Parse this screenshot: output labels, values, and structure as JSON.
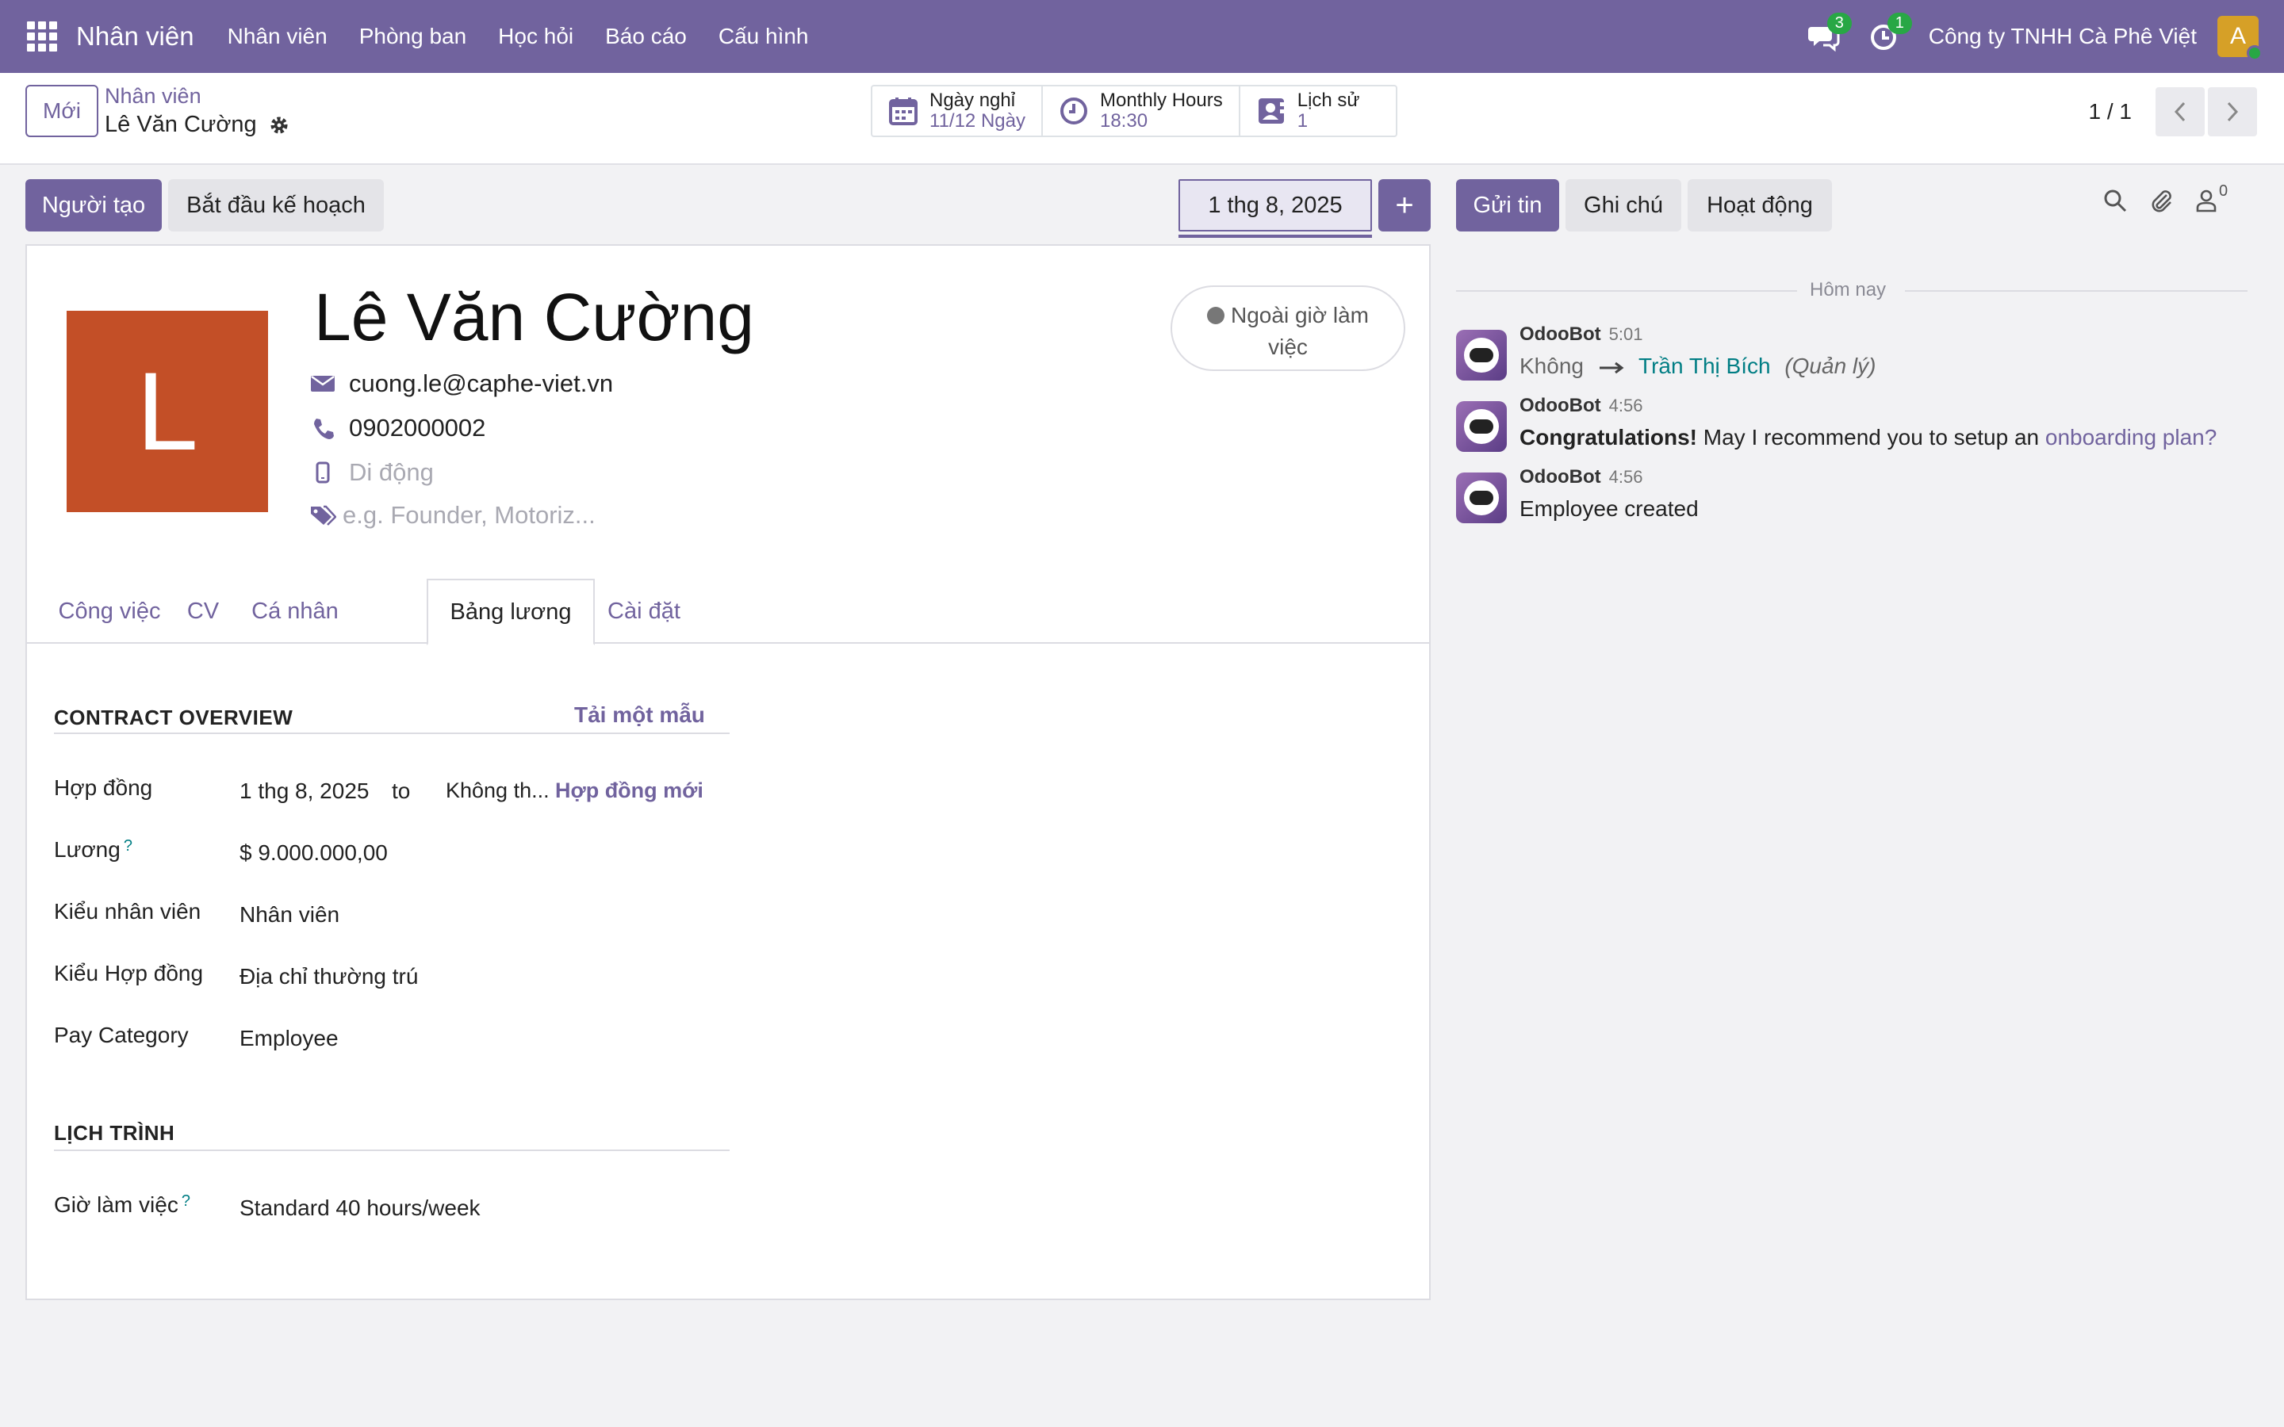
{
  "navbar": {
    "brand": "Nhân viên",
    "menu": [
      "Nhân viên",
      "Phòng ban",
      "Học hỏi",
      "Báo cáo",
      "Cấu hình"
    ],
    "messages_count": "3",
    "activities_count": "1",
    "company": "Công ty TNHH Cà Phê Việt",
    "avatar_letter": "A"
  },
  "control": {
    "new_label": "Mới",
    "breadcrumb_parent": "Nhân viên",
    "breadcrumb_current": "Lê Văn Cường",
    "smart_buttons": [
      {
        "title": "Ngày nghỉ",
        "value": "11/12 Ngày",
        "icon": "calendar-icon"
      },
      {
        "title": "Monthly Hours",
        "value": "18:30",
        "icon": "clock-icon"
      },
      {
        "title": "Lịch sử",
        "value": "1",
        "icon": "contact-card-icon"
      }
    ],
    "pager": "1 / 1"
  },
  "actions": {
    "creator": "Người tạo",
    "start_plan": "Bắt đầu kế hoạch",
    "date": "1 thg 8, 2025",
    "add_symbol": "+"
  },
  "employee": {
    "avatar_letter": "L",
    "name": "Lê Văn Cường",
    "email": "cuong.le@caphe-viet.vn",
    "phone": "0902000002",
    "mobile_placeholder": "Di động",
    "tags_placeholder": "e.g. Founder, Motoriz...",
    "status_line1": "Ngoài giờ làm",
    "status_line2": "việc"
  },
  "tabs": [
    "Công việc",
    "CV",
    "Cá nhân",
    "Bảng lương",
    "Cài đặt"
  ],
  "active_tab": "Bảng lương",
  "payroll": {
    "contract_title": "CONTRACT OVERVIEW",
    "load_template": "Tải một mẫu",
    "contract_label": "Hợp đồng",
    "contract_start": "1 thg 8, 2025",
    "contract_to": "to",
    "contract_end_placeholder": "Không th...",
    "new_contract": "Hợp đồng mới",
    "wage_label": "Lương",
    "wage_value": "$ 9.000.000,00",
    "employee_type_label": "Kiểu nhân viên",
    "employee_type_value": "Nhân viên",
    "contract_type_label": "Kiểu Hợp đồng",
    "contract_type_value": "Địa chỉ thường trú",
    "pay_category_label": "Pay Category",
    "pay_category_value": "Employee",
    "schedule_title": "LỊCH TRÌNH",
    "working_hours_label": "Giờ làm việc",
    "working_hours_value": "Standard 40 hours/week",
    "help_mark": "?"
  },
  "chatter": {
    "send_message": "Gửi tin",
    "log_note": "Ghi chú",
    "activity": "Hoạt động",
    "followers_count": "0",
    "today": "Hôm nay",
    "messages": [
      {
        "author": "OdooBot",
        "time": "5:01",
        "from": "Không",
        "to": "Trần Thị Bích",
        "field": "(Quản lý)"
      },
      {
        "author": "OdooBot",
        "time": "4:56",
        "bold": "Congratulations!",
        "text": " May I recommend you to setup an ",
        "link": "onboarding plan?"
      },
      {
        "author": "OdooBot",
        "time": "4:56",
        "text": "Employee created"
      }
    ]
  },
  "colors": {
    "brand": "#71639e",
    "avatar_employee": "#c34f27",
    "badge": "#28a745",
    "link_teal": "#017e84"
  }
}
